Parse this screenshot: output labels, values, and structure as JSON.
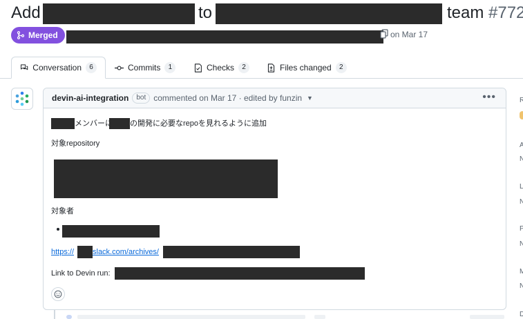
{
  "title": {
    "prefix": "Add",
    "middle": "to",
    "suffix": "team",
    "number": "#772"
  },
  "status": {
    "badge": "Merged",
    "date_text": "on Mar 17"
  },
  "tabs": [
    {
      "label": "Conversation",
      "count": "6"
    },
    {
      "label": "Commits",
      "count": "1"
    },
    {
      "label": "Checks",
      "count": "2"
    },
    {
      "label": "Files changed",
      "count": "2"
    }
  ],
  "comment": {
    "author": "devin-ai-integration",
    "bot_label": "bot",
    "meta": "commented on Mar 17 · edited by funzin",
    "line1_a": "メンバーに",
    "line1_b": "の開発に必要なrepoを見れるように追加",
    "repo_heading": "対象repository",
    "target_heading": "対象者",
    "link_prefix": "https://",
    "link_mid": "slack.com/archives/",
    "devin_label": "Link to Devin run:"
  },
  "sidebar_letters": [
    "R",
    "A",
    "N",
    "L",
    "N",
    "P",
    "N",
    "M",
    "N",
    "D"
  ],
  "colors": {
    "merged": "#8250df",
    "link": "#0969da",
    "border": "#d1d9e0",
    "redaction": "#2b2b2b"
  },
  "icons": {
    "merged": "git-merge-icon",
    "conversation": "comment-discussion-icon",
    "commits": "git-commit-icon",
    "checks": "checklist-icon",
    "files": "file-diff-icon",
    "emoji": "smiley-icon",
    "copy": "copy-icon"
  }
}
